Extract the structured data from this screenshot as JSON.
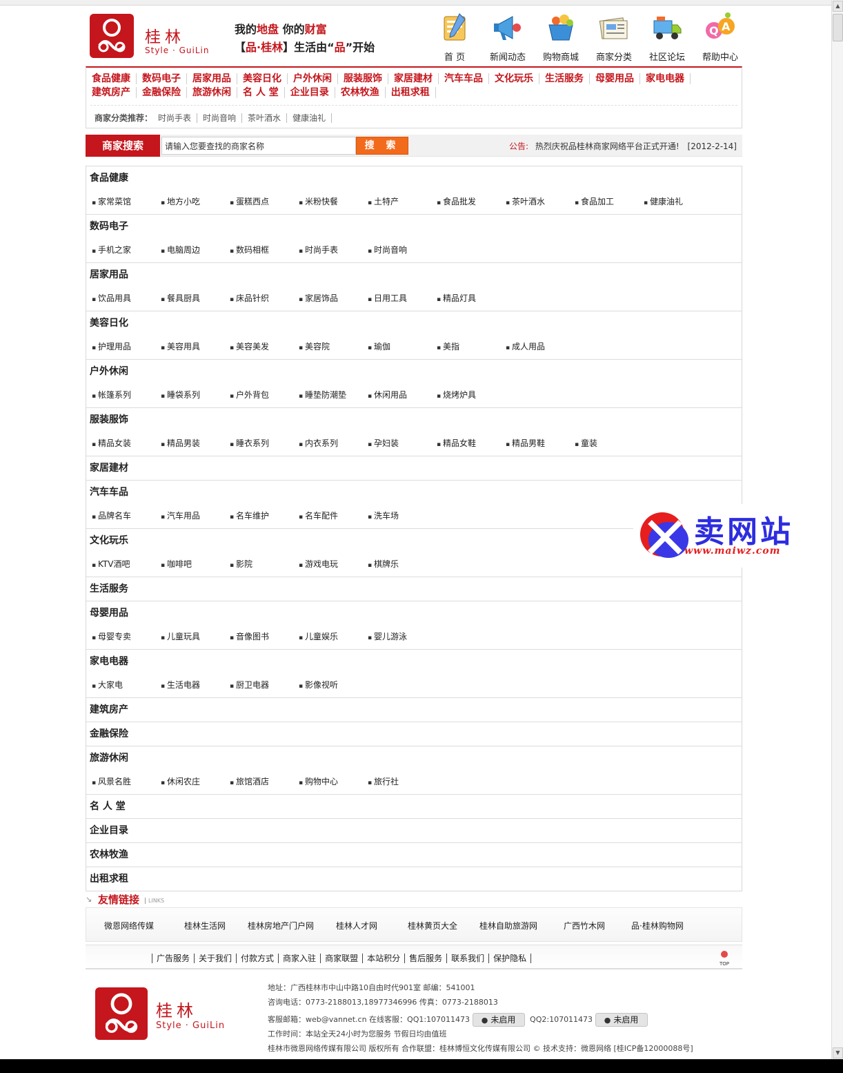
{
  "header": {
    "logo_cn": "桂林",
    "logo_en": "Style · GuiLin",
    "slogan_line1_a": "我的",
    "slogan_line1_b": "地盘",
    "slogan_line1_c": "你的",
    "slogan_line1_d": "财富",
    "slogan_line2_a": "【",
    "slogan_line2_b": "品·桂林",
    "slogan_line2_c": "】生活由“",
    "slogan_line2_d": "品",
    "slogan_line2_e": "”开始",
    "nav": [
      {
        "label": "首  页",
        "icon": "notebook-icon"
      },
      {
        "label": "新闻动态",
        "icon": "megaphone-icon"
      },
      {
        "label": "购物商城",
        "icon": "shopping-basket-icon"
      },
      {
        "label": "商家分类",
        "icon": "newspaper-stack-icon"
      },
      {
        "label": "社区论坛",
        "icon": "truck-icon"
      },
      {
        "label": "帮助中心",
        "icon": "qa-icon"
      }
    ]
  },
  "categories_row1": [
    "食品健康",
    "数码电子",
    "居家用品",
    "美容日化",
    "户外休闲",
    "服装服饰",
    "家居建材",
    "汽车车品",
    "文化玩乐",
    "生活服务",
    "母婴用品",
    "家电电器"
  ],
  "categories_row2": [
    "建筑房产",
    "金融保险",
    "旅游休闲",
    "名 人 堂",
    "企业目录",
    "农林牧渔",
    "出租求租"
  ],
  "recommend": {
    "label": "商家分类推荐：",
    "items": [
      "时尚手表",
      "时尚音响",
      "茶叶酒水",
      "健康油礼"
    ]
  },
  "search": {
    "title": "商家搜索",
    "placeholder": "请输入您要查找的商家名称",
    "button": "搜 索"
  },
  "notice": {
    "label": "公告:",
    "text": "热烈庆祝品桂林商家网络平台正式开通!",
    "date": "[2012-2-14]"
  },
  "sections": [
    {
      "title": "食品健康",
      "items": [
        "家常菜馆",
        "地方小吃",
        "蛋糕西点",
        "米粉快餐",
        "土特产",
        "食品批发",
        "茶叶酒水",
        "食品加工",
        "健康油礼"
      ]
    },
    {
      "title": "数码电子",
      "items": [
        "手机之家",
        "电脑周边",
        "数码相框",
        "时尚手表",
        "时尚音响"
      ]
    },
    {
      "title": "居家用品",
      "items": [
        "饮品用具",
        "餐具厨具",
        "床品针织",
        "家居饰品",
        "日用工具",
        "精品灯具"
      ]
    },
    {
      "title": "美容日化",
      "items": [
        "护理用品",
        "美容用具",
        "美容美发",
        "美容院",
        "瑜伽",
        "美指",
        "成人用品"
      ]
    },
    {
      "title": "户外休闲",
      "items": [
        "帐篷系列",
        "睡袋系列",
        "户外背包",
        "睡垫防潮垫",
        "休闲用品",
        "烧烤炉具"
      ]
    },
    {
      "title": "服装服饰",
      "items": [
        "精品女装",
        "精品男装",
        "睡衣系列",
        "内衣系列",
        " 孕妇装",
        "精品女鞋",
        "精品男鞋",
        "童装"
      ]
    },
    {
      "title": "家居建材",
      "items": []
    },
    {
      "title": "汽车车品",
      "items": [
        "品牌名车",
        "汽车用品",
        "名车维护",
        "名车配件",
        "洗车场"
      ]
    },
    {
      "title": "文化玩乐",
      "items": [
        "KTV酒吧",
        "咖啡吧",
        "影院",
        "游戏电玩",
        "棋牌乐"
      ]
    },
    {
      "title": "生活服务",
      "items": []
    },
    {
      "title": "母婴用品",
      "items": [
        "母婴专卖",
        "儿童玩具",
        "音像图书",
        "儿童娱乐",
        "婴儿游泳"
      ]
    },
    {
      "title": "家电电器",
      "items": [
        "大家电",
        "生活电器",
        "厨卫电器",
        "影像视听"
      ]
    },
    {
      "title": "建筑房产",
      "items": []
    },
    {
      "title": "金融保险",
      "items": []
    },
    {
      "title": "旅游休闲",
      "items": [
        "风景名胜",
        "休闲农庄",
        "旅馆酒店",
        "购物中心",
        "旅行社"
      ]
    },
    {
      "title": "名 人 堂",
      "items": []
    },
    {
      "title": "企业目录",
      "items": []
    },
    {
      "title": "农林牧渔",
      "items": []
    },
    {
      "title": "出租求租",
      "items": []
    }
  ],
  "watermark": {
    "cn": "卖网站",
    "url": "www.maiwz.com"
  },
  "links": {
    "title": "友情链接",
    "sub": "LINKS",
    "items": [
      "微恩网络传媒",
      "桂林生活网",
      "桂林房地产门户网",
      "桂林人才网",
      "桂林黄页大全",
      "桂林自助旅游网",
      "广西竹木网",
      "品·桂林购物网"
    ]
  },
  "footer_nav": [
    "广告服务",
    "关于我们",
    "付款方式",
    "商家入驻",
    "商家联盟",
    "本站积分",
    "售后服务",
    "联系我们",
    "保护隐私"
  ],
  "top_button": "TOP",
  "footer": {
    "logo_cn": "桂林",
    "logo_en": "Style · GuiLin",
    "address": "地址：广西桂林市中山中路10自由时代901室  邮编：541001",
    "phone": "咨询电话：0773-2188013,18977346996  传真：0773-2188013",
    "email_prefix": "客服邮箱：web@vannet.cn  在线客服：QQ1:107011473",
    "qq2": "QQ2:107011473",
    "qq_status": "未启用",
    "hours": "工作时间：本站全天24小时为您服务  节假日均由值班",
    "copyright": "桂林市微恩网络传媒有限公司  版权所有  合作联盟：桂林博恒文化传媒有限公司 © 技术支持：微恩网络 [桂ICP备12000088号]"
  },
  "colors": {
    "brand_red": "#c4161c",
    "search_orange": "#f26a1b",
    "watermark_blue": "#2d2de0"
  }
}
